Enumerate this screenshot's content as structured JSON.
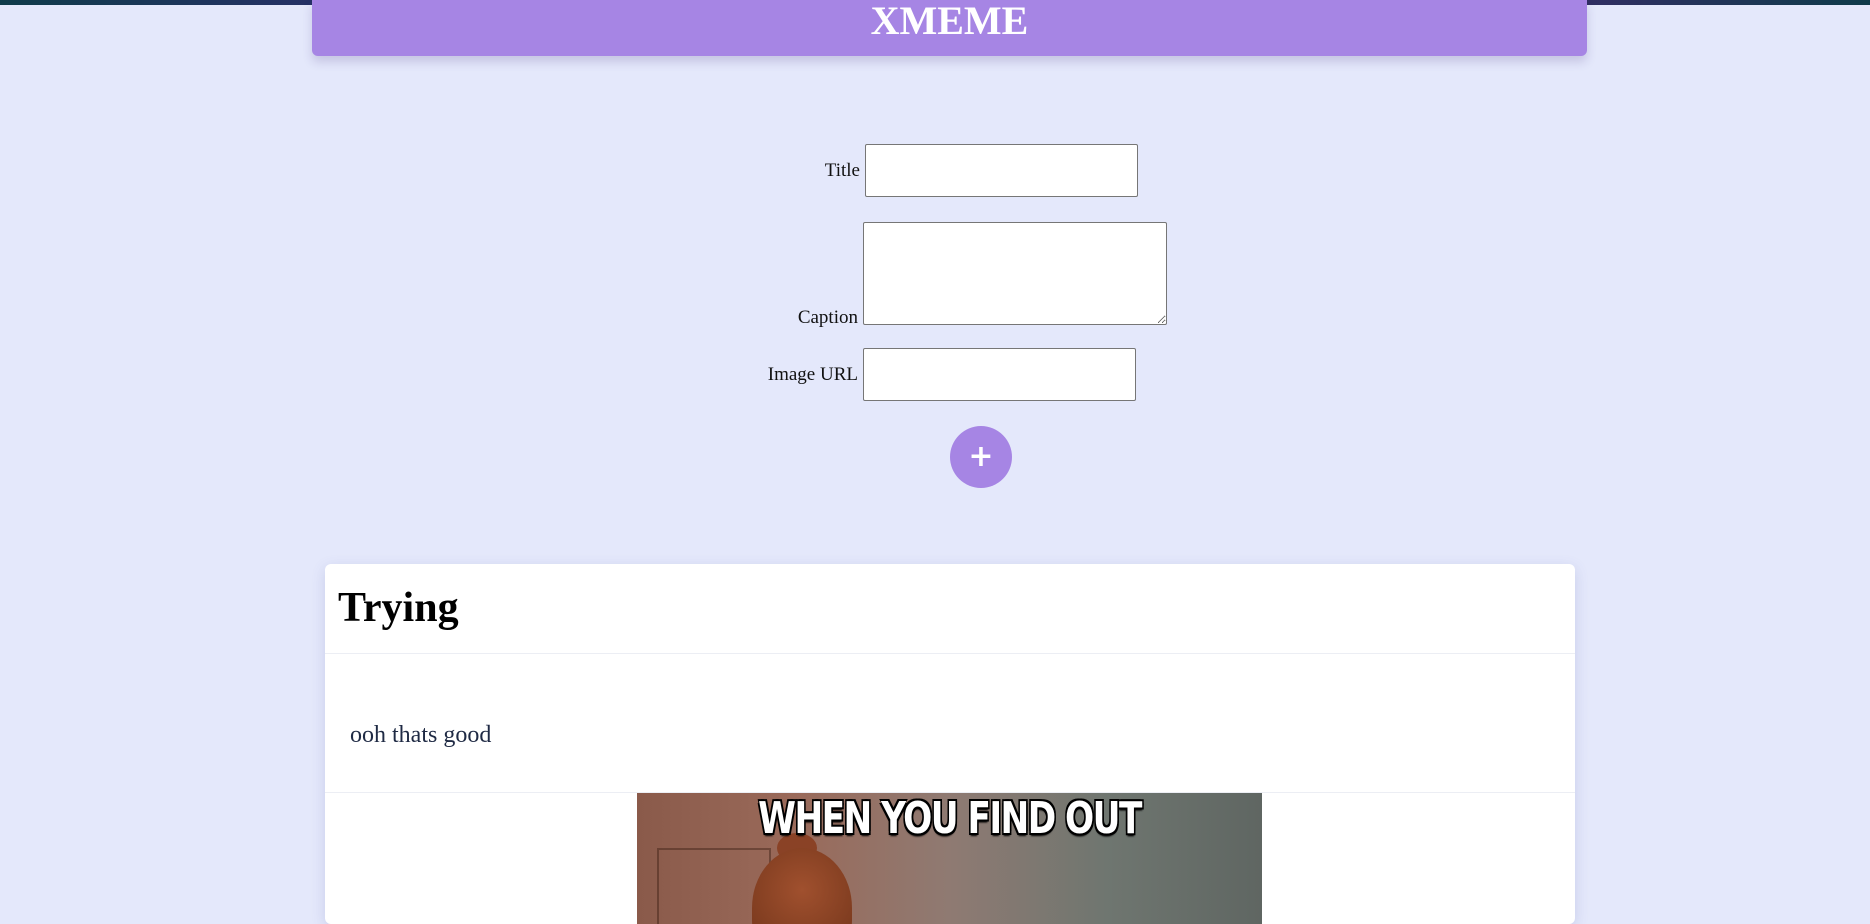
{
  "header": {
    "title": "XMEME"
  },
  "form": {
    "title_label": "Title",
    "title_value": "",
    "caption_label": "Caption",
    "caption_value": "",
    "image_url_label": "Image URL",
    "image_url_value": "",
    "submit_label": "+"
  },
  "memes": [
    {
      "title": "Trying",
      "caption": "ooh thats good",
      "image_text": "WHEN YOU FIND OUT"
    }
  ],
  "colors": {
    "accent": "#a685e4",
    "background": "#e4e8fb",
    "card": "#ffffff"
  }
}
